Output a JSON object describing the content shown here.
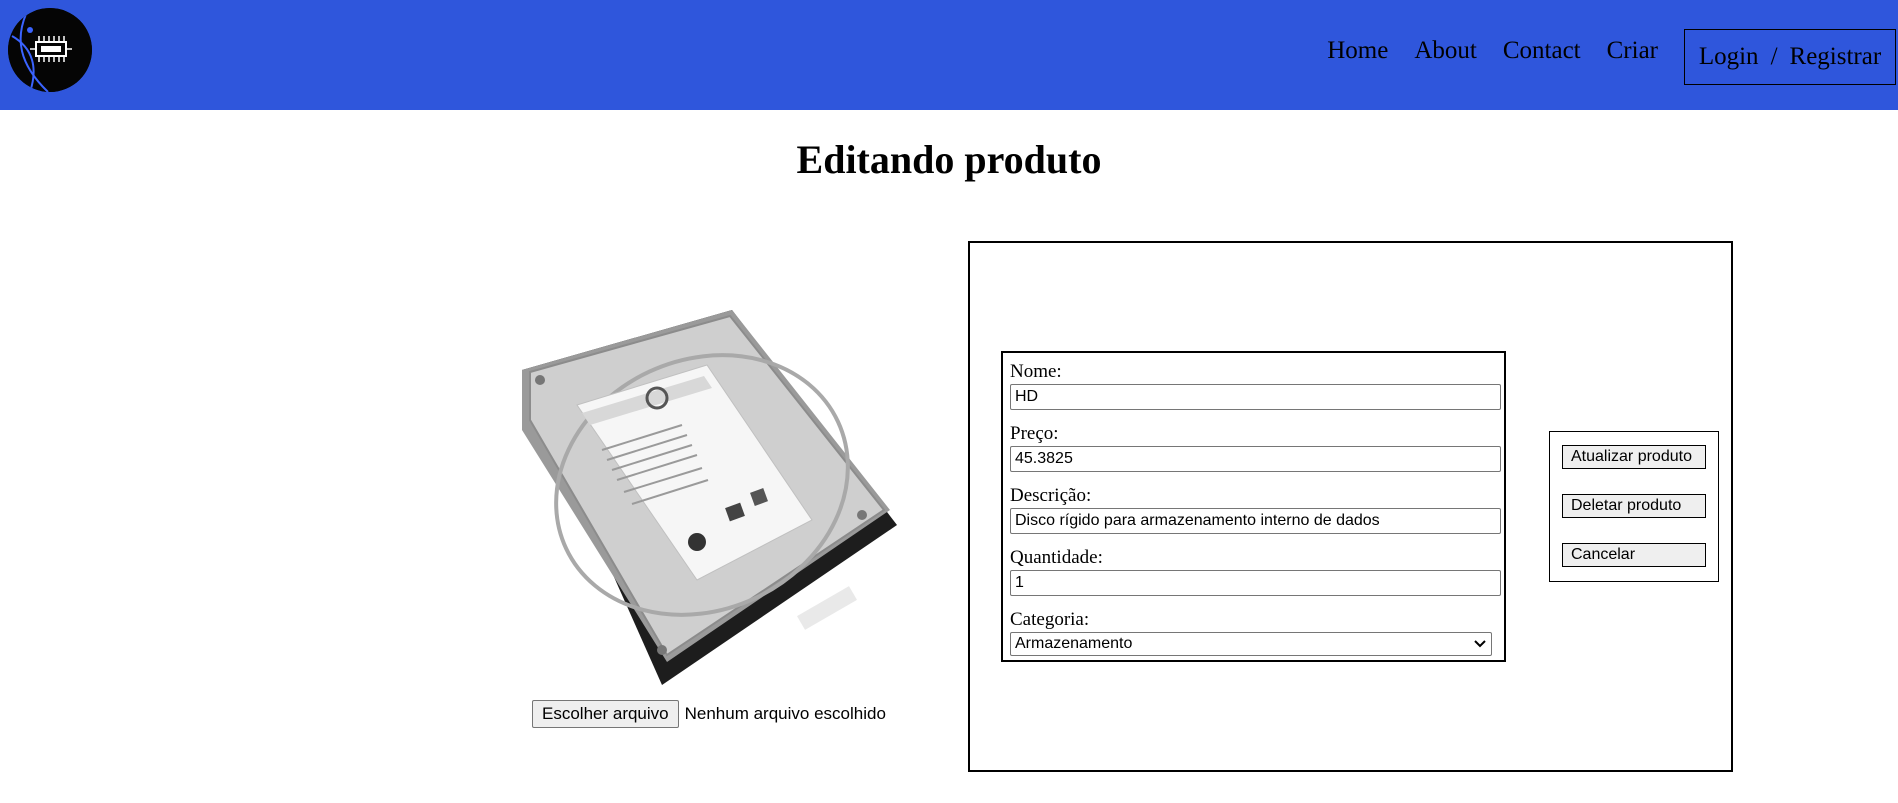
{
  "nav": {
    "links": [
      "Home",
      "About",
      "Contact",
      "Criar"
    ],
    "login_label": "Login",
    "separator": "/",
    "register_label": "Registrar"
  },
  "page": {
    "title": "Editando produto"
  },
  "image_upload": {
    "button_label": "Escolher arquivo",
    "status_text": "Nenhum arquivo escolhido"
  },
  "form": {
    "fields": [
      {
        "label": "Nome:",
        "value": "HD"
      },
      {
        "label": "Preço:",
        "value": "45.3825"
      },
      {
        "label": "Descrição:",
        "value": "Disco rígido para armazenamento interno de dados"
      },
      {
        "label": "Quantidade:",
        "value": "1"
      }
    ],
    "category": {
      "label": "Categoria:",
      "selected": "Armazenamento"
    }
  },
  "actions": {
    "update_label": "Atualizar produto",
    "delete_label": "Deletar produto",
    "cancel_label": "Cancelar"
  },
  "colors": {
    "header_bg": "#2f56dc",
    "logo_bg": "#050505"
  },
  "icons": {
    "logo": "circuit-chip-logo-icon",
    "product": "hard-drive-image",
    "select": "chevron-down-icon"
  }
}
